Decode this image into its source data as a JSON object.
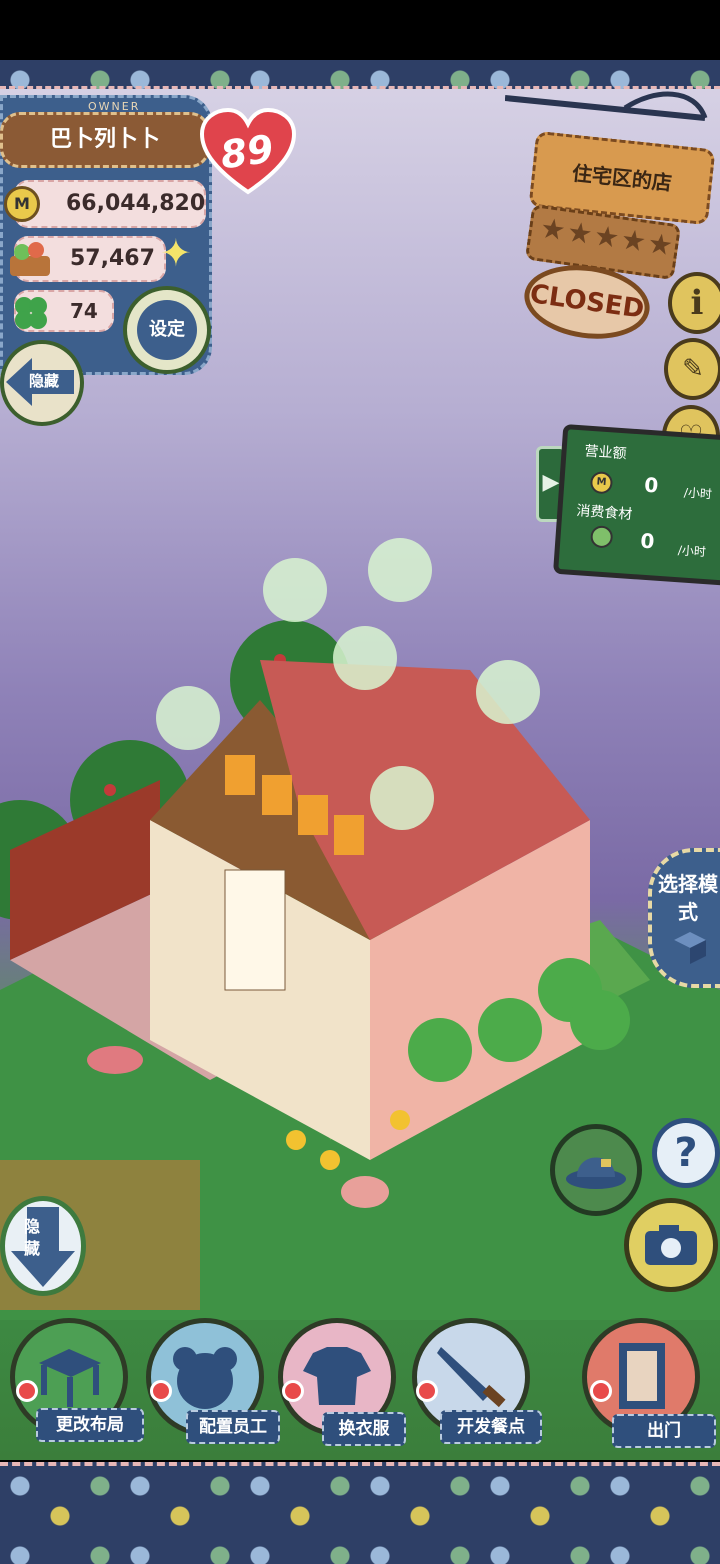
{
  "owner": {
    "label": "OWNER",
    "name": "巴卜列卜卜",
    "level": "89"
  },
  "stats": {
    "money": "66,044,820",
    "food": "57,467",
    "clover": "74",
    "coin_symbol": "M"
  },
  "buttons": {
    "settings": "设定",
    "hide_top": "隐藏",
    "hide_bottom": "隐藏",
    "select_mode": "选择模式"
  },
  "shop": {
    "name": "住宅区的店",
    "status": "CLOSED",
    "stars": "★★★★★"
  },
  "earnings": {
    "revenue_label": "营业额",
    "revenue_value": "0",
    "revenue_unit": "/小时",
    "food_label": "消费食材",
    "food_value": "0",
    "food_unit": "/小时"
  },
  "side_icons": {
    "info": "i",
    "help": "?"
  },
  "toolbar": [
    {
      "label": "更改布局",
      "icon": "table-icon"
    },
    {
      "label": "配置员工",
      "icon": "bear-icon"
    },
    {
      "label": "换衣服",
      "icon": "shirt-icon"
    },
    {
      "label": "开发餐点",
      "icon": "knife-icon"
    },
    {
      "label": "出门",
      "icon": "door-icon"
    }
  ],
  "colors": {
    "denim": "#3d5f8c",
    "wood": "#8b5a35",
    "grass": "#3e8f46",
    "heart": "#e0444c",
    "board": "#2d6d3c"
  }
}
